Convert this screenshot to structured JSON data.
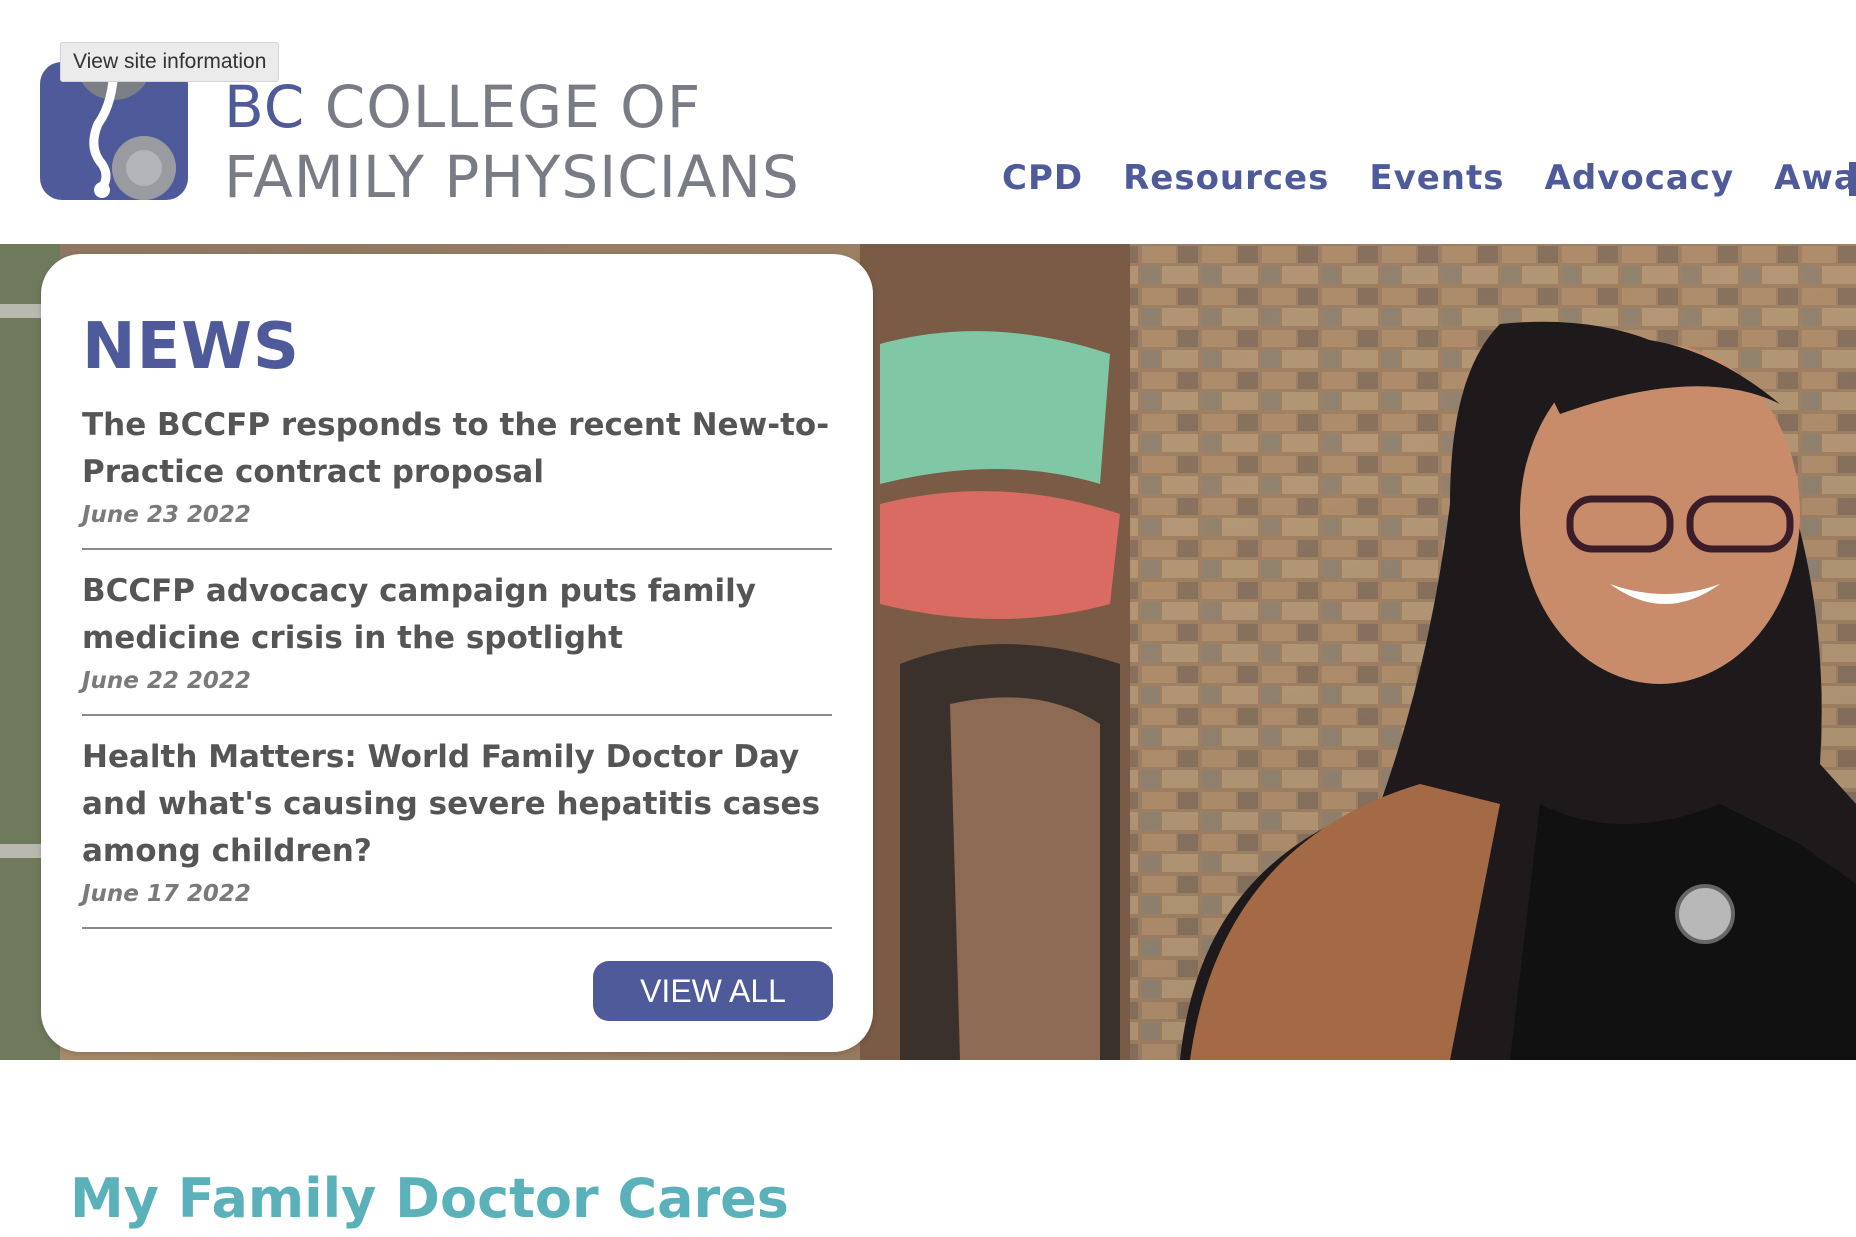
{
  "browser": {
    "tooltip": "View site information"
  },
  "header": {
    "logo": {
      "line1_accent": "BC",
      "line1_rest": " COLLEGE OF",
      "line2": "FAMILY PHYSICIANS"
    },
    "nav": [
      "CPD",
      "Resources",
      "Events",
      "Advocacy",
      "Awards"
    ]
  },
  "news": {
    "title": "NEWS",
    "items": [
      {
        "headline": "The BCCFP responds to the recent New-to-Practice contract proposal",
        "date": "June 23 2022"
      },
      {
        "headline": "BCCFP advocacy campaign puts family medicine crisis in the spotlight",
        "date": "June 22 2022"
      },
      {
        "headline": "Health Matters: World Family Doctor Day and what's causing severe hepatitis cases among children?",
        "date": "June 17 2022"
      }
    ],
    "view_all_label": "VIEW ALL"
  },
  "section": {
    "heading": "My Family Doctor Cares"
  },
  "colors": {
    "brand": "#4f5a9a",
    "teal_heading": "#5ab1b9",
    "logo_gray": "#7a7c85"
  }
}
